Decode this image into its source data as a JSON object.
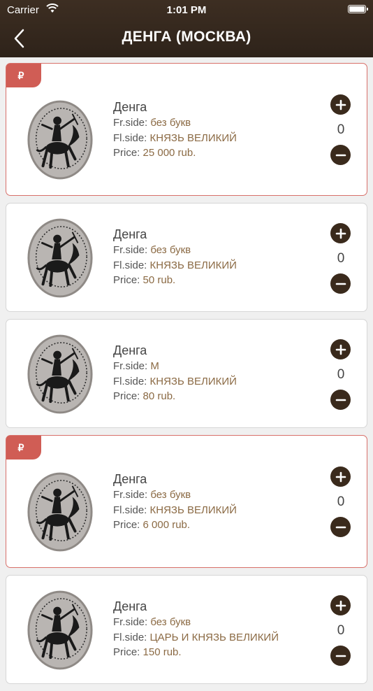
{
  "status": {
    "carrier": "Carrier",
    "time": "1:01 PM"
  },
  "header": {
    "title": "ДЕНГА (МОСКВА)"
  },
  "labels": {
    "front": "Fr.side: ",
    "flip": "Fl.side: ",
    "price": "Price: "
  },
  "badge_symbol": "₽",
  "colors": {
    "header": "#33271d",
    "accent": "#8b6a44",
    "badge": "#d05d55",
    "button": "#3a2a1c"
  },
  "items": [
    {
      "name": "Денга",
      "front": "без букв",
      "flip": "КНЯЗЬ ВЕЛИКИЙ",
      "price": "25 000 rub.",
      "qty": "0",
      "rare": true
    },
    {
      "name": "Денга",
      "front": "без букв",
      "flip": "КНЯЗЬ ВЕЛИКИЙ",
      "price": "50 rub.",
      "qty": "0",
      "rare": false
    },
    {
      "name": "Денга",
      "front": "М",
      "flip": "КНЯЗЬ ВЕЛИКИЙ",
      "price": "80 rub.",
      "qty": "0",
      "rare": false
    },
    {
      "name": "Денга",
      "front": "без букв",
      "flip": "КНЯЗЬ ВЕЛИКИЙ",
      "price": "6 000 rub.",
      "qty": "0",
      "rare": true
    },
    {
      "name": "Денга",
      "front": "без букв",
      "flip": "ЦАРЬ И КНЯЗЬ ВЕЛИКИЙ",
      "price": "150 rub.",
      "qty": "0",
      "rare": false
    }
  ]
}
